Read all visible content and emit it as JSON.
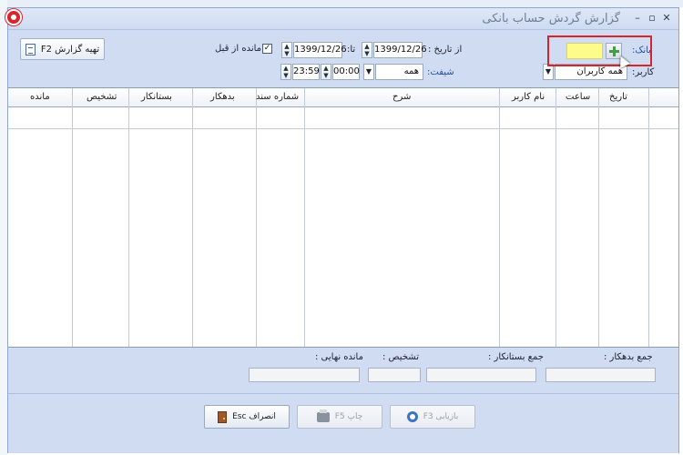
{
  "window": {
    "title": "گزارش گردش حساب بانکی",
    "controls": {
      "minimize": "–",
      "maximize": "▫",
      "close": "✕"
    }
  },
  "toolbar": {
    "prepare_report_label": "تهیه گزارش F2",
    "bank_label": "بانک:",
    "bank_value": "",
    "user_label": "کاربر:",
    "user_value": "همه کاربران",
    "from_date_label": "از تاریخ :",
    "from_date_value": "1399/12/26",
    "to_date_label": "تا:",
    "to_date_value": "1399/12/26",
    "prev_balance_label": "مانده از قبل",
    "prev_balance_checked": true,
    "shift_label": "شیفت:",
    "shift_value": "همه",
    "time_from_value": "00:00",
    "time_to_value": "23:59"
  },
  "grid": {
    "columns": [
      "تاریخ",
      "ساعت",
      "نام کاربر",
      "شرح",
      "شماره سند",
      "بدهکار",
      "بستانکار",
      "تشخیص",
      "مانده"
    ],
    "rows": []
  },
  "totals": {
    "debit_label": "جمع بدهکار :",
    "credit_label": "جمع بستانکار :",
    "detect_label": "تشخیص :",
    "final_balance_label": "مانده نهایی :",
    "debit_value": "",
    "credit_value": "",
    "detect_value": "",
    "final_balance_value": ""
  },
  "footer": {
    "refresh_label": "بازیابی F3",
    "print_label": "چاپ F5",
    "cancel_label": "انصراف Esc"
  },
  "colors": {
    "window_bg": "#cfdcf1",
    "highlight_border": "#d4262c",
    "bank_input_bg": "#fdfb8a",
    "label_blue": "#2a4fa0"
  },
  "icons": [
    "app-logo-icon",
    "document-icon",
    "plus-icon",
    "mouse-cursor-icon",
    "refresh-icon",
    "printer-icon",
    "exit-door-icon"
  ]
}
